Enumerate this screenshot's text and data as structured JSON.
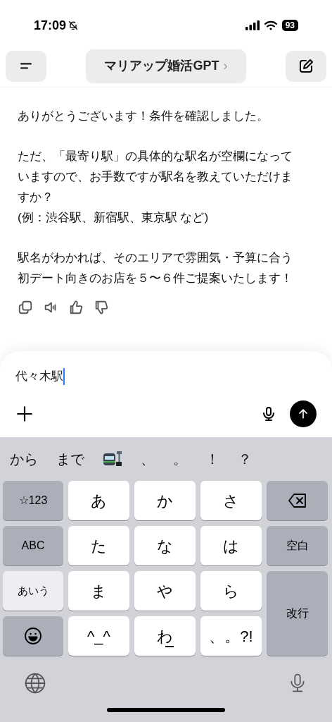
{
  "status_bar": {
    "time": "17:09",
    "battery": "93"
  },
  "header": {
    "title": "マリアップ婚活GPT",
    "chevron": "›"
  },
  "message": {
    "blocks": [
      [
        "ありがとうございます！条件を確認しました。"
      ],
      [
        "ただ、「最寄り駅」の具体的な駅名が空欄になっていますので、お手数ですが駅名を教えていただけますか？",
        "(例：渋谷駅、新宿駅、東京駅 など)"
      ],
      [
        "駅名がわかれば、そのエリアで雰囲気・予算に合う初デート向きのお店を５〜６件ご提案いたします！"
      ]
    ]
  },
  "composer": {
    "value": "代々木駅"
  },
  "suggestions": [
    {
      "kind": "text",
      "text": "から"
    },
    {
      "kind": "text",
      "text": "まで"
    },
    {
      "kind": "train"
    },
    {
      "kind": "text",
      "text": "、"
    },
    {
      "kind": "text",
      "text": "。"
    },
    {
      "kind": "text",
      "text": "！"
    },
    {
      "kind": "text",
      "text": "？"
    }
  ],
  "keys": [
    {
      "kind": "function",
      "label": "☆123"
    },
    {
      "kind": "letter",
      "label": "あ"
    },
    {
      "kind": "letter",
      "label": "か"
    },
    {
      "kind": "letter",
      "label": "さ"
    },
    {
      "kind": "delete"
    },
    {
      "kind": "function",
      "label": "ABC"
    },
    {
      "kind": "letter",
      "label": "た"
    },
    {
      "kind": "letter",
      "label": "な"
    },
    {
      "kind": "letter",
      "label": "は"
    },
    {
      "kind": "function",
      "label": "空白"
    },
    {
      "kind": "mode",
      "label": "あいう"
    },
    {
      "kind": "letter",
      "label": "ま"
    },
    {
      "kind": "letter",
      "label": "や"
    },
    {
      "kind": "letter",
      "label": "ら"
    },
    {
      "kind": "enter",
      "label": "改行"
    },
    {
      "kind": "emoji"
    },
    {
      "kind": "letter",
      "label": "^_^"
    },
    {
      "kind": "letter",
      "label": "わ",
      "underline": true
    },
    {
      "kind": "letter",
      "label": "、。?!"
    }
  ]
}
